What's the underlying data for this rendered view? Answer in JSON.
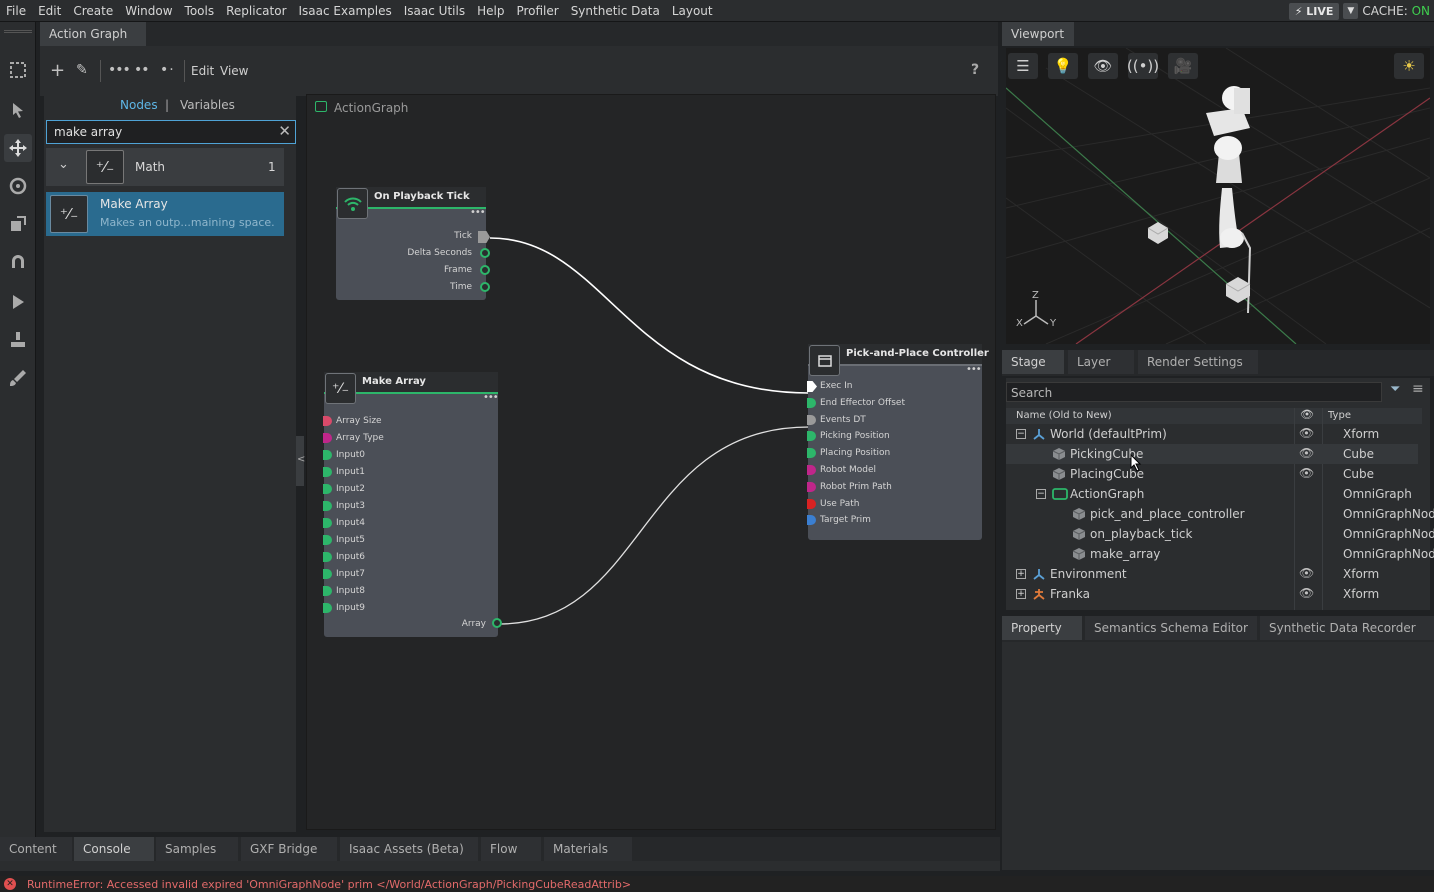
{
  "menubar": {
    "items": [
      "File",
      "Edit",
      "Create",
      "Window",
      "Tools",
      "Replicator",
      "Isaac Examples",
      "Isaac Utils",
      "Help",
      "Profiler",
      "Synthetic Data",
      "Layout"
    ],
    "live_label": "LIVE",
    "cache_label": "CACHE:",
    "cache_value": "ON"
  },
  "left_toolbar": {
    "icons": [
      "select-box-icon",
      "pointer-icon",
      "move-icon",
      "rotate-icon",
      "scale-icon",
      "snap-icon",
      "play-icon",
      "physics-icon",
      "paint-icon"
    ]
  },
  "action_graph": {
    "tab_label": "Action Graph",
    "edit_label": "Edit",
    "view_label": "View",
    "help_label": "?",
    "library": {
      "tab_nodes": "Nodes",
      "tab_separator": "|",
      "tab_variables": "Variables",
      "search_value": "make array",
      "category": {
        "label": "Math",
        "count": "1"
      },
      "result": {
        "title": "Make Array",
        "description": "Makes an outp...maining space."
      }
    },
    "graph": {
      "breadcrumb": "ActionGraph",
      "collapse_label": "<",
      "nodes": {
        "playback": {
          "title": "On Playback Tick",
          "outputs": [
            "Tick",
            "Delta Seconds",
            "Frame",
            "Time"
          ]
        },
        "make_array": {
          "title": "Make Array",
          "inputs": [
            "Array Size",
            "Array Type",
            "Input0",
            "Input1",
            "Input2",
            "Input3",
            "Input4",
            "Input5",
            "Input6",
            "Input7",
            "Input8",
            "Input9"
          ],
          "output": "Array"
        },
        "controller": {
          "title": "Pick-and-Place Controller",
          "inputs": [
            "Exec In",
            "End Effector Offset",
            "Events DT",
            "Picking Position",
            "Placing Position",
            "Robot Model",
            "Robot Prim Path",
            "Use Path",
            "Target Prim"
          ]
        }
      }
    }
  },
  "viewport": {
    "tab_label": "Viewport",
    "axis_z": "Z",
    "axis_x": "X",
    "axis_y": "Y"
  },
  "stage": {
    "tabs": [
      "Stage",
      "Layer",
      "Render Settings"
    ],
    "search_placeholder": "Search",
    "col_name": "Name (Old to New)",
    "col_type": "Type",
    "rows": [
      {
        "name": "World (defaultPrim)",
        "type": "Xform"
      },
      {
        "name": "PickingCube",
        "type": "Cube"
      },
      {
        "name": "PlacingCube",
        "type": "Cube"
      },
      {
        "name": "ActionGraph",
        "type": "OmniGraph"
      },
      {
        "name": "pick_and_place_controller",
        "type": "OmniGraphNode"
      },
      {
        "name": "on_playback_tick",
        "type": "OmniGraphNode"
      },
      {
        "name": "make_array",
        "type": "OmniGraphNode"
      },
      {
        "name": "Environment",
        "type": "Xform"
      },
      {
        "name": "Franka",
        "type": "Xform"
      }
    ]
  },
  "property_tabs": [
    "Property",
    "Semantics Schema Editor",
    "Synthetic Data Recorder"
  ],
  "bottom_tabs": [
    "Content",
    "Console",
    "Samples",
    "GXF Bridge",
    "Isaac Assets (Beta)",
    "Flow",
    "Materials"
  ],
  "status": {
    "error_text": "RuntimeError: Accessed invalid expired 'OmniGraphNode' prim </World/ActionGraph/PickingCubeReadAttrib>"
  },
  "colors": {
    "accent_green": "#2db66a",
    "selection_blue": "#2a6b8f",
    "error_red": "#e05050",
    "port_magenta": "#c0268a",
    "port_red": "#d92222",
    "port_blue": "#3b7fd1"
  }
}
